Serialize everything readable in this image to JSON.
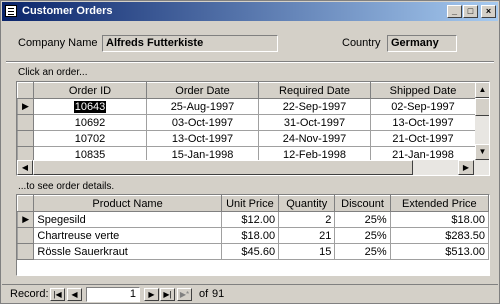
{
  "window": {
    "title": "Customer Orders",
    "buttons": {
      "minimize": "_",
      "maximize": "□",
      "close": "×"
    }
  },
  "header": {
    "company_label": "Company Name",
    "company_value": "Alfreds Futterkiste",
    "country_label": "Country",
    "country_value": "Germany"
  },
  "orders": {
    "caption": "Click an order...",
    "columns": [
      "Order ID",
      "Order Date",
      "Required Date",
      "Shipped Date"
    ],
    "rows": [
      [
        "10643",
        "25-Aug-1997",
        "22-Sep-1997",
        "02-Sep-1997"
      ],
      [
        "10692",
        "03-Oct-1997",
        "31-Oct-1997",
        "13-Oct-1997"
      ],
      [
        "10702",
        "13-Oct-1997",
        "24-Nov-1997",
        "21-Oct-1997"
      ],
      [
        "10835",
        "15-Jan-1998",
        "12-Feb-1998",
        "21-Jan-1998"
      ]
    ],
    "current_row_marker": "▶"
  },
  "details": {
    "caption": "...to see order details.",
    "columns": [
      "Product Name",
      "Unit Price",
      "Quantity",
      "Discount",
      "Extended Price"
    ],
    "rows": [
      [
        "Spegesild",
        "$12.00",
        "2",
        "25%",
        "$18.00"
      ],
      [
        "Chartreuse verte",
        "$18.00",
        "21",
        "25%",
        "$283.50"
      ],
      [
        "Rössle Sauerkraut",
        "$45.60",
        "15",
        "25%",
        "$513.00"
      ]
    ],
    "current_row_marker": "▶"
  },
  "navigation": {
    "record_label": "Record:",
    "first": "|◀",
    "prev": "◀",
    "next": "▶",
    "last": "▶|",
    "new": "▶*",
    "current_record": "1",
    "of_label": "of",
    "total_records": "91"
  }
}
